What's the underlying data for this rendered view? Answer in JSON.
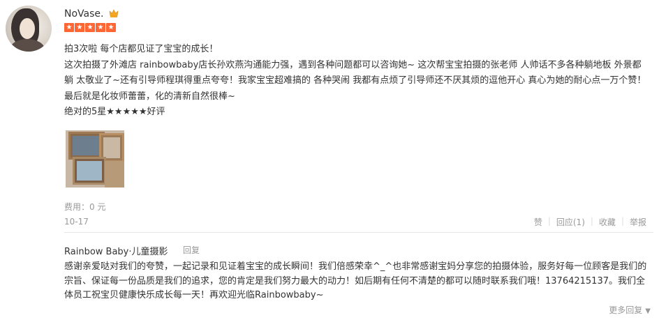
{
  "user": {
    "name": "NoVase.",
    "vip_icon": "crown-icon",
    "rating_stars": 5
  },
  "review": {
    "line1": "拍3次啦 每个店都见证了宝宝的成长！",
    "line2": "这次拍摄了外滩店 rainbowbaby店长孙欢燕沟通能力强，遇到各种问题都可以咨询她~ 这次帮宝宝拍摄的张老师 人帅话不多各种躺地板 外景都躺 太敬业了~还有引导师程琪得重点夸夸！我家宝宝超难搞的 各种哭闹 我都有点烦了引导师还不厌其烦的逗他开心 真心为她的耐心点一万个赞！最后就是化妆师蕾蕾，化的清新自然很棒~",
    "line3": "绝对的5星★★★★★好评"
  },
  "meta": {
    "cost": "费用：0 元",
    "date": "10-17"
  },
  "actions": {
    "like": "赞",
    "reply": "回应(1)",
    "favorite": "收藏",
    "report": "举报"
  },
  "shop_reply": {
    "shop_name": "Rainbow Baby·儿童摄影",
    "reply_link": "回复",
    "text": "感谢亲爱哒对我们的夸赞，一起记录和见证着宝宝的成长瞬间！我们倍感荣幸^_^也非常感谢宝妈分享您的拍摄体验，服务好每一位顾客是我们的宗旨、保证每一份品质是我们的追求，您的肯定是我们努力最大的动力！如后期有任何不清楚的都可以随时联系我们哦！13764215137。我们全体员工祝宝贝健康快乐成长每一天！再欢迎光临Rainbowbaby~",
    "more": "更多回复"
  },
  "colors": {
    "star": "#ff6633",
    "muted": "#999999"
  }
}
